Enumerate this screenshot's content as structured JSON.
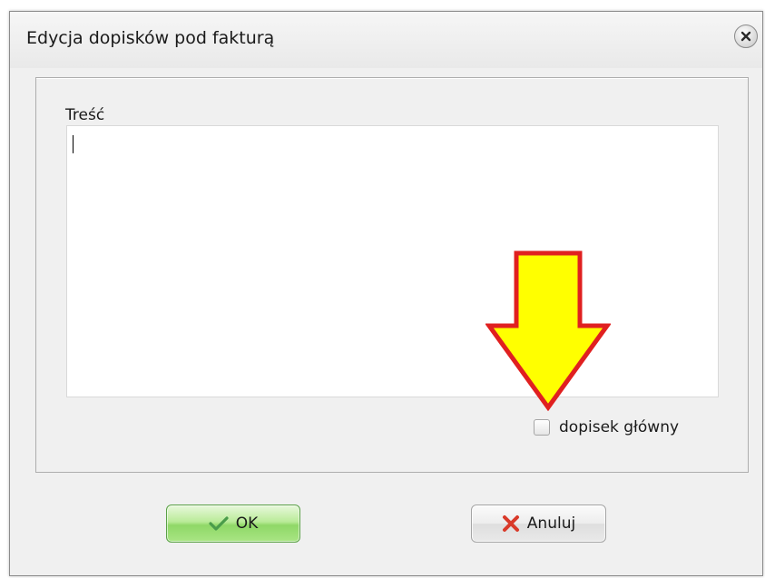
{
  "dialog": {
    "title": "Edycja dopisków pod fakturą",
    "close_icon": "close-icon"
  },
  "form": {
    "content_label": "Treść",
    "content_value": "",
    "main_note_checkbox": {
      "label": "dopisek główny",
      "checked": false
    }
  },
  "annotation": {
    "arrow_icon": "down-arrow-icon",
    "fill_color": "#ffff00",
    "stroke_color": "#e02020"
  },
  "buttons": {
    "ok_label": "OK",
    "ok_icon": "checkmark-icon",
    "cancel_label": "Anuluj",
    "cancel_icon": "cross-icon"
  }
}
